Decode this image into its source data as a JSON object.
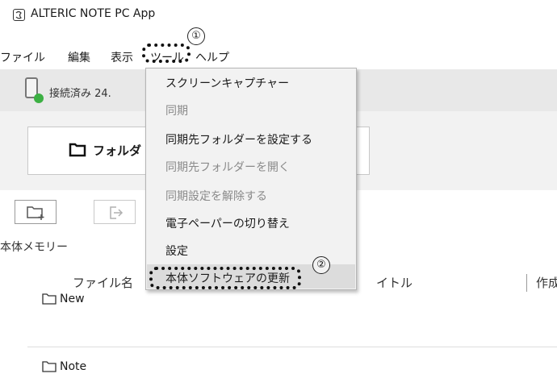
{
  "app": {
    "title": "ALTERIC NOTE PC App"
  },
  "menubar": {
    "items": [
      {
        "label": "ファイル"
      },
      {
        "label": "編集"
      },
      {
        "label": "表示"
      },
      {
        "label": "ツール"
      },
      {
        "label": "ヘルプ"
      }
    ]
  },
  "status": {
    "text": "接続済み 24.",
    "indicator_color": "#3cb043"
  },
  "toolbar": {
    "folder_button_label": "フォルダ"
  },
  "memory": {
    "label": "本体メモリー"
  },
  "table": {
    "columns": [
      "ファイル名",
      "イトル",
      "作成"
    ],
    "rows": [
      {
        "name": "New"
      },
      {
        "name": "Note"
      }
    ]
  },
  "dropdown": {
    "items": [
      {
        "label": "スクリーンキャプチャー",
        "enabled": true
      },
      {
        "label": "同期",
        "enabled": false
      },
      {
        "label": "同期先フォルダーを設定する",
        "enabled": true
      },
      {
        "label": "同期先フォルダーを開く",
        "enabled": false
      },
      {
        "label": "同期設定を解除する",
        "enabled": false
      },
      {
        "label": "電子ペーパーの切り替え",
        "enabled": true
      },
      {
        "label": "設定",
        "enabled": true
      },
      {
        "label": "本体ソフトウェアの更新",
        "enabled": true,
        "highlighted": true
      }
    ]
  },
  "annotations": {
    "step1": "①",
    "step2": "②"
  },
  "icons": [
    "app-icon",
    "device-icon",
    "folder-icon",
    "new-folder-icon",
    "move-icon"
  ]
}
